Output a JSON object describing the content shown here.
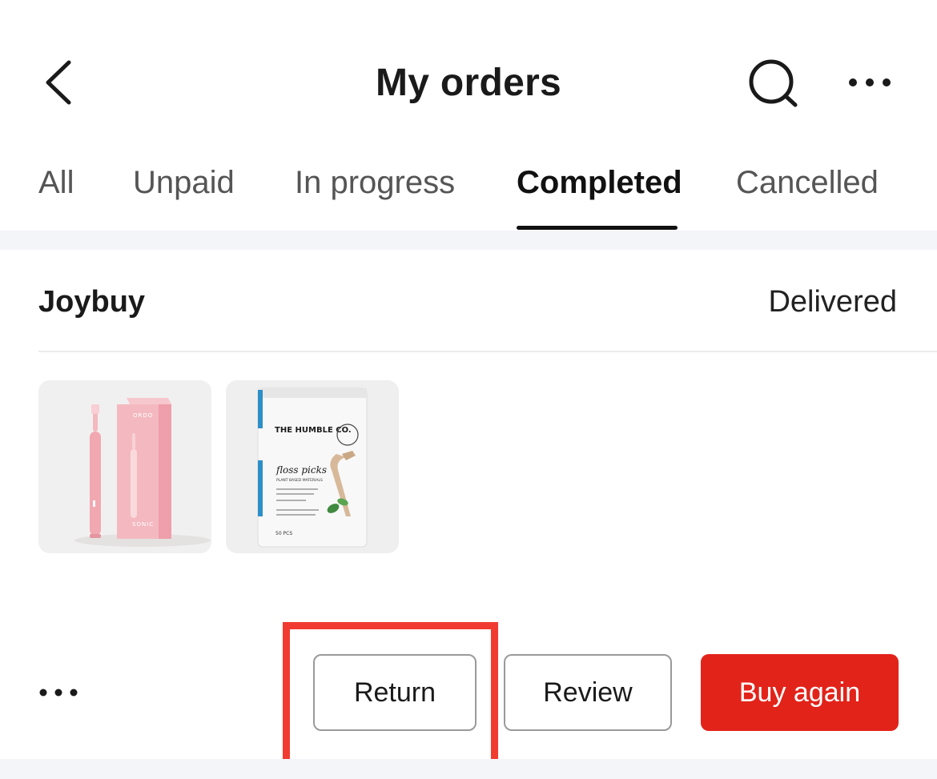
{
  "header": {
    "title": "My orders",
    "back_icon": "chevron-left-icon",
    "search_icon": "search-icon",
    "more_icon": "more-horizontal-icon"
  },
  "tabs": [
    {
      "label": "All",
      "active": false
    },
    {
      "label": "Unpaid",
      "active": false
    },
    {
      "label": "In progress",
      "active": false
    },
    {
      "label": "Completed",
      "active": true
    },
    {
      "label": "Cancelled",
      "active": false
    }
  ],
  "order": {
    "store": "Joybuy",
    "status": "Delivered",
    "products": [
      {
        "name": "Pink sonic electric toothbrush with box",
        "box_text": "ORDO",
        "box_subtext": "SONIC"
      },
      {
        "name": "The Humble Co. floss picks",
        "brand_text": "THE HUMBLE CO.",
        "product_text": "floss picks",
        "subtext": "PLANT BASED MATERIALS",
        "count_text": "50 PCS"
      }
    ],
    "actions": {
      "more_icon": "more-horizontal-icon",
      "return_label": "Return",
      "review_label": "Review",
      "buy_again_label": "Buy again"
    }
  },
  "colors": {
    "accent_red": "#e2231a",
    "highlight_red": "#f23b30",
    "tab_active": "#111111",
    "tab_inactive": "#555555"
  }
}
